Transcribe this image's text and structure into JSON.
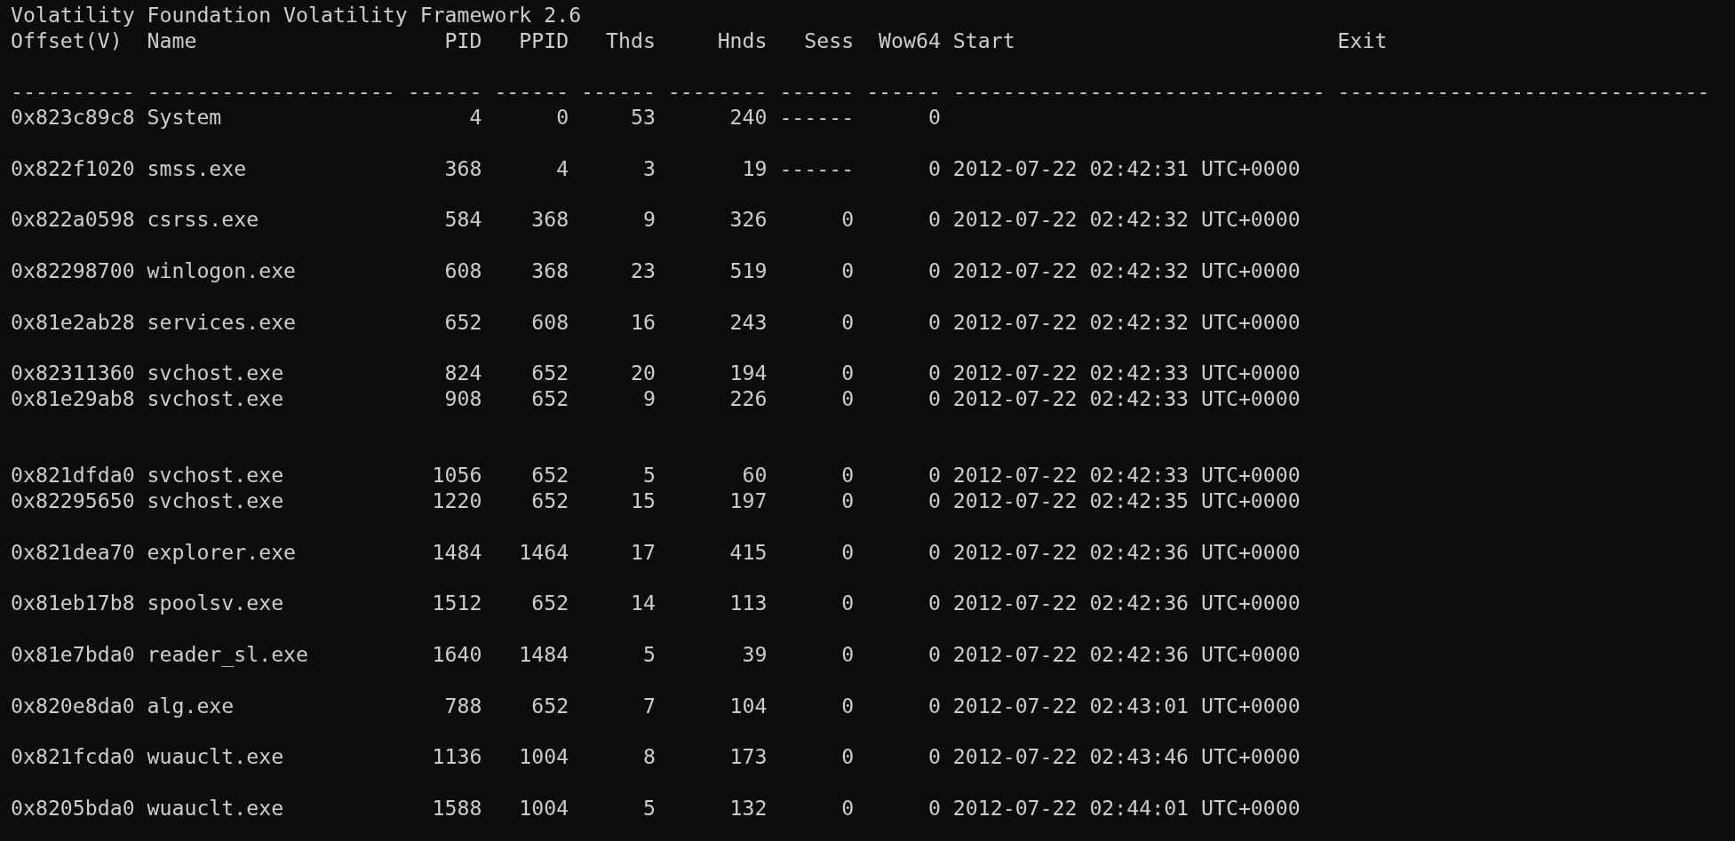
{
  "banner": "Volatility Foundation Volatility Framework 2.6",
  "columns": [
    "Offset(V)",
    "Name",
    "PID",
    "PPID",
    "Thds",
    "Hnds",
    "Sess",
    "Wow64",
    "Start",
    "Exit"
  ],
  "separator": [
    "----------",
    "--------------------",
    "------",
    "------",
    "------",
    "--------",
    "------",
    "------",
    "------------------------------",
    "------------------------------"
  ],
  "lines": [
    {
      "kind": "row",
      "cells": [
        "0x823c89c8",
        "System",
        "4",
        "0",
        "53",
        "240",
        "------",
        "0"
      ]
    },
    {
      "kind": "blank"
    },
    {
      "kind": "row",
      "cells": [
        "0x822f1020",
        "smss.exe",
        "368",
        "4",
        "3",
        "19",
        "------",
        "0",
        "2012-07-22 02:42:31 UTC+0000"
      ]
    },
    {
      "kind": "blank"
    },
    {
      "kind": "row",
      "cells": [
        "0x822a0598",
        "csrss.exe",
        "584",
        "368",
        "9",
        "326",
        "0",
        "0",
        "2012-07-22 02:42:32 UTC+0000"
      ]
    },
    {
      "kind": "blank"
    },
    {
      "kind": "row",
      "cells": [
        "0x82298700",
        "winlogon.exe",
        "608",
        "368",
        "23",
        "519",
        "0",
        "0",
        "2012-07-22 02:42:32 UTC+0000"
      ]
    },
    {
      "kind": "blank"
    },
    {
      "kind": "row",
      "cells": [
        "0x81e2ab28",
        "services.exe",
        "652",
        "608",
        "16",
        "243",
        "0",
        "0",
        "2012-07-22 02:42:32 UTC+0000"
      ]
    },
    {
      "kind": "blank"
    },
    {
      "kind": "row",
      "cells": [
        "0x82311360",
        "svchost.exe",
        "824",
        "652",
        "20",
        "194",
        "0",
        "0",
        "2012-07-22 02:42:33 UTC+0000"
      ]
    },
    {
      "kind": "row",
      "cells": [
        "0x81e29ab8",
        "svchost.exe",
        "908",
        "652",
        "9",
        "226",
        "0",
        "0",
        "2012-07-22 02:42:33 UTC+0000"
      ]
    },
    {
      "kind": "blank"
    },
    {
      "kind": "blank"
    },
    {
      "kind": "row",
      "cells": [
        "0x821dfda0",
        "svchost.exe",
        "1056",
        "652",
        "5",
        "60",
        "0",
        "0",
        "2012-07-22 02:42:33 UTC+0000"
      ]
    },
    {
      "kind": "row",
      "cells": [
        "0x82295650",
        "svchost.exe",
        "1220",
        "652",
        "15",
        "197",
        "0",
        "0",
        "2012-07-22 02:42:35 UTC+0000"
      ]
    },
    {
      "kind": "blank"
    },
    {
      "kind": "row",
      "cells": [
        "0x821dea70",
        "explorer.exe",
        "1484",
        "1464",
        "17",
        "415",
        "0",
        "0",
        "2012-07-22 02:42:36 UTC+0000"
      ]
    },
    {
      "kind": "blank"
    },
    {
      "kind": "row",
      "cells": [
        "0x81eb17b8",
        "spoolsv.exe",
        "1512",
        "652",
        "14",
        "113",
        "0",
        "0",
        "2012-07-22 02:42:36 UTC+0000"
      ]
    },
    {
      "kind": "blank"
    },
    {
      "kind": "row",
      "cells": [
        "0x81e7bda0",
        "reader_sl.exe",
        "1640",
        "1484",
        "5",
        "39",
        "0",
        "0",
        "2012-07-22 02:42:36 UTC+0000"
      ]
    },
    {
      "kind": "blank"
    },
    {
      "kind": "row",
      "cells": [
        "0x820e8da0",
        "alg.exe",
        "788",
        "652",
        "7",
        "104",
        "0",
        "0",
        "2012-07-22 02:43:01 UTC+0000"
      ]
    },
    {
      "kind": "blank"
    },
    {
      "kind": "row",
      "cells": [
        "0x821fcda0",
        "wuauclt.exe",
        "1136",
        "1004",
        "8",
        "173",
        "0",
        "0",
        "2012-07-22 02:43:46 UTC+0000"
      ]
    },
    {
      "kind": "blank"
    },
    {
      "kind": "row",
      "cells": [
        "0x8205bda0",
        "wuauclt.exe",
        "1588",
        "1004",
        "5",
        "132",
        "0",
        "0",
        "2012-07-22 02:44:01 UTC+0000"
      ]
    }
  ]
}
